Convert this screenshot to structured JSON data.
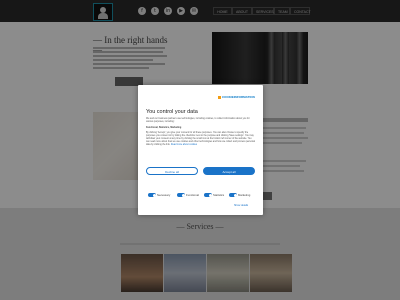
{
  "nav": {
    "items": [
      "HOME",
      "ABOUT",
      "SERVICES",
      "TEAM",
      "CONTACT"
    ]
  },
  "social": {
    "icons": [
      "facebook-icon",
      "twitter-icon",
      "linkedin-icon",
      "youtube-icon",
      "email-icon"
    ],
    "glyphs": [
      "f",
      "t",
      "in",
      "▶",
      "✉"
    ]
  },
  "hero": {
    "title": "— In the right hands —"
  },
  "services": {
    "title": "— Services —"
  },
  "consent": {
    "provider": "COOKIEINFORMATION",
    "title": "You control your data",
    "intro": "We and our business partners use technologies, including cookies, to collect information about you for various purposes, including:",
    "purposes": "Functional, Statistics, Marketing",
    "details": "By clicking 'Accept', you give your consent for all these purposes. You can also choose to specify the purposes you consent to by ticking the checkbox next to the purpose and clicking 'Save settings'. You may withdraw your consent at any time by clicking the small icon at the bottom left corner of the website. You can read more about how we use cookies and other technologies and how we collect and process personal data by clicking the link.",
    "read_more": "Read more about cookies",
    "decline_label": "Decline all",
    "accept_label": "Accept all",
    "categories": [
      "Necessary",
      "Functional",
      "Statistics",
      "Marketing"
    ],
    "show_details": "Show details"
  },
  "colors": {
    "accent": "#1a73c8",
    "topbar": "#2a2a2a",
    "brand_orange": "#f39c12"
  }
}
